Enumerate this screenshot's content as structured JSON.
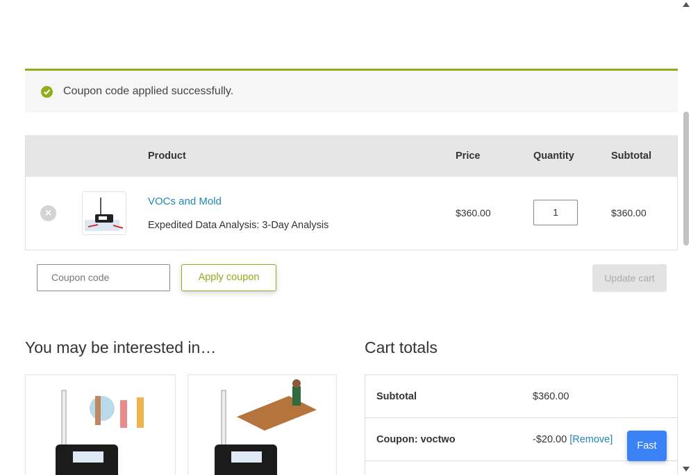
{
  "notice": {
    "message": "Coupon code applied successfully.",
    "icon": "check-circle-icon",
    "color": "#8fae1b"
  },
  "cart": {
    "headers": {
      "product": "Product",
      "price": "Price",
      "quantity": "Quantity",
      "subtotal": "Subtotal"
    },
    "items": [
      {
        "name": "VOCs and Mold",
        "meta": "Expedited Data Analysis: 3-Day Analysis",
        "price": "$360.00",
        "quantity": "1",
        "subtotal": "$360.00",
        "remove_icon": "×"
      }
    ]
  },
  "coupon": {
    "placeholder": "Coupon code",
    "apply_label": "Apply coupon",
    "update_label": "Update cart"
  },
  "upsell": {
    "title": "You may be interested in…"
  },
  "totals": {
    "title": "Cart totals",
    "rows": [
      {
        "label": "Subtotal",
        "value": "$360.00"
      },
      {
        "label": "Coupon: voctwo",
        "value": "-$20.00",
        "link": "[Remove]"
      }
    ]
  },
  "fast_button": "Fast",
  "colors": {
    "accent": "#8fae1b",
    "link": "#1e88b6",
    "fast": "#3b82f6"
  }
}
